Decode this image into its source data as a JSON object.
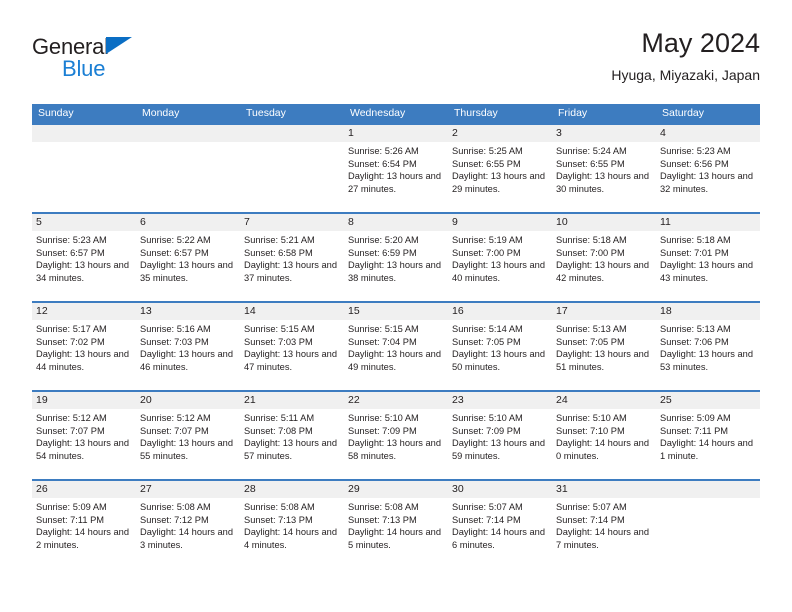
{
  "brand": {
    "line1": "General",
    "line2": "Blue",
    "triangle_color": "#0a6ec4",
    "blue_color": "#1b7fd4"
  },
  "header": {
    "title": "May 2024",
    "location": "Hyuga, Miyazaki, Japan"
  },
  "theme": {
    "header_blue": "#3d7cc0",
    "row_border_blue": "#3d7cc0",
    "daynum_band": "#f0f0f0",
    "text": "#231f20"
  },
  "weekdays": [
    "Sunday",
    "Monday",
    "Tuesday",
    "Wednesday",
    "Thursday",
    "Friday",
    "Saturday"
  ],
  "labels": {
    "sunrise_prefix": "Sunrise:",
    "sunset_prefix": "Sunset:",
    "daylight_prefix": "Daylight:"
  },
  "weeks": [
    [
      {
        "day": "",
        "sunrise": "",
        "sunset": "",
        "daylight": "",
        "empty": true
      },
      {
        "day": "",
        "sunrise": "",
        "sunset": "",
        "daylight": "",
        "empty": true
      },
      {
        "day": "",
        "sunrise": "",
        "sunset": "",
        "daylight": "",
        "empty": true
      },
      {
        "day": "1",
        "sunrise": "Sunrise: 5:26 AM",
        "sunset": "Sunset: 6:54 PM",
        "daylight": "Daylight: 13 hours and 27 minutes."
      },
      {
        "day": "2",
        "sunrise": "Sunrise: 5:25 AM",
        "sunset": "Sunset: 6:55 PM",
        "daylight": "Daylight: 13 hours and 29 minutes."
      },
      {
        "day": "3",
        "sunrise": "Sunrise: 5:24 AM",
        "sunset": "Sunset: 6:55 PM",
        "daylight": "Daylight: 13 hours and 30 minutes."
      },
      {
        "day": "4",
        "sunrise": "Sunrise: 5:23 AM",
        "sunset": "Sunset: 6:56 PM",
        "daylight": "Daylight: 13 hours and 32 minutes."
      }
    ],
    [
      {
        "day": "5",
        "sunrise": "Sunrise: 5:23 AM",
        "sunset": "Sunset: 6:57 PM",
        "daylight": "Daylight: 13 hours and 34 minutes."
      },
      {
        "day": "6",
        "sunrise": "Sunrise: 5:22 AM",
        "sunset": "Sunset: 6:57 PM",
        "daylight": "Daylight: 13 hours and 35 minutes."
      },
      {
        "day": "7",
        "sunrise": "Sunrise: 5:21 AM",
        "sunset": "Sunset: 6:58 PM",
        "daylight": "Daylight: 13 hours and 37 minutes."
      },
      {
        "day": "8",
        "sunrise": "Sunrise: 5:20 AM",
        "sunset": "Sunset: 6:59 PM",
        "daylight": "Daylight: 13 hours and 38 minutes."
      },
      {
        "day": "9",
        "sunrise": "Sunrise: 5:19 AM",
        "sunset": "Sunset: 7:00 PM",
        "daylight": "Daylight: 13 hours and 40 minutes."
      },
      {
        "day": "10",
        "sunrise": "Sunrise: 5:18 AM",
        "sunset": "Sunset: 7:00 PM",
        "daylight": "Daylight: 13 hours and 42 minutes."
      },
      {
        "day": "11",
        "sunrise": "Sunrise: 5:18 AM",
        "sunset": "Sunset: 7:01 PM",
        "daylight": "Daylight: 13 hours and 43 minutes."
      }
    ],
    [
      {
        "day": "12",
        "sunrise": "Sunrise: 5:17 AM",
        "sunset": "Sunset: 7:02 PM",
        "daylight": "Daylight: 13 hours and 44 minutes."
      },
      {
        "day": "13",
        "sunrise": "Sunrise: 5:16 AM",
        "sunset": "Sunset: 7:03 PM",
        "daylight": "Daylight: 13 hours and 46 minutes."
      },
      {
        "day": "14",
        "sunrise": "Sunrise: 5:15 AM",
        "sunset": "Sunset: 7:03 PM",
        "daylight": "Daylight: 13 hours and 47 minutes."
      },
      {
        "day": "15",
        "sunrise": "Sunrise: 5:15 AM",
        "sunset": "Sunset: 7:04 PM",
        "daylight": "Daylight: 13 hours and 49 minutes."
      },
      {
        "day": "16",
        "sunrise": "Sunrise: 5:14 AM",
        "sunset": "Sunset: 7:05 PM",
        "daylight": "Daylight: 13 hours and 50 minutes."
      },
      {
        "day": "17",
        "sunrise": "Sunrise: 5:13 AM",
        "sunset": "Sunset: 7:05 PM",
        "daylight": "Daylight: 13 hours and 51 minutes."
      },
      {
        "day": "18",
        "sunrise": "Sunrise: 5:13 AM",
        "sunset": "Sunset: 7:06 PM",
        "daylight": "Daylight: 13 hours and 53 minutes."
      }
    ],
    [
      {
        "day": "19",
        "sunrise": "Sunrise: 5:12 AM",
        "sunset": "Sunset: 7:07 PM",
        "daylight": "Daylight: 13 hours and 54 minutes."
      },
      {
        "day": "20",
        "sunrise": "Sunrise: 5:12 AM",
        "sunset": "Sunset: 7:07 PM",
        "daylight": "Daylight: 13 hours and 55 minutes."
      },
      {
        "day": "21",
        "sunrise": "Sunrise: 5:11 AM",
        "sunset": "Sunset: 7:08 PM",
        "daylight": "Daylight: 13 hours and 57 minutes."
      },
      {
        "day": "22",
        "sunrise": "Sunrise: 5:10 AM",
        "sunset": "Sunset: 7:09 PM",
        "daylight": "Daylight: 13 hours and 58 minutes."
      },
      {
        "day": "23",
        "sunrise": "Sunrise: 5:10 AM",
        "sunset": "Sunset: 7:09 PM",
        "daylight": "Daylight: 13 hours and 59 minutes."
      },
      {
        "day": "24",
        "sunrise": "Sunrise: 5:10 AM",
        "sunset": "Sunset: 7:10 PM",
        "daylight": "Daylight: 14 hours and 0 minutes."
      },
      {
        "day": "25",
        "sunrise": "Sunrise: 5:09 AM",
        "sunset": "Sunset: 7:11 PM",
        "daylight": "Daylight: 14 hours and 1 minute."
      }
    ],
    [
      {
        "day": "26",
        "sunrise": "Sunrise: 5:09 AM",
        "sunset": "Sunset: 7:11 PM",
        "daylight": "Daylight: 14 hours and 2 minutes."
      },
      {
        "day": "27",
        "sunrise": "Sunrise: 5:08 AM",
        "sunset": "Sunset: 7:12 PM",
        "daylight": "Daylight: 14 hours and 3 minutes."
      },
      {
        "day": "28",
        "sunrise": "Sunrise: 5:08 AM",
        "sunset": "Sunset: 7:13 PM",
        "daylight": "Daylight: 14 hours and 4 minutes."
      },
      {
        "day": "29",
        "sunrise": "Sunrise: 5:08 AM",
        "sunset": "Sunset: 7:13 PM",
        "daylight": "Daylight: 14 hours and 5 minutes."
      },
      {
        "day": "30",
        "sunrise": "Sunrise: 5:07 AM",
        "sunset": "Sunset: 7:14 PM",
        "daylight": "Daylight: 14 hours and 6 minutes."
      },
      {
        "day": "31",
        "sunrise": "Sunrise: 5:07 AM",
        "sunset": "Sunset: 7:14 PM",
        "daylight": "Daylight: 14 hours and 7 minutes."
      },
      {
        "day": "",
        "sunrise": "",
        "sunset": "",
        "daylight": "",
        "empty": true
      }
    ]
  ]
}
